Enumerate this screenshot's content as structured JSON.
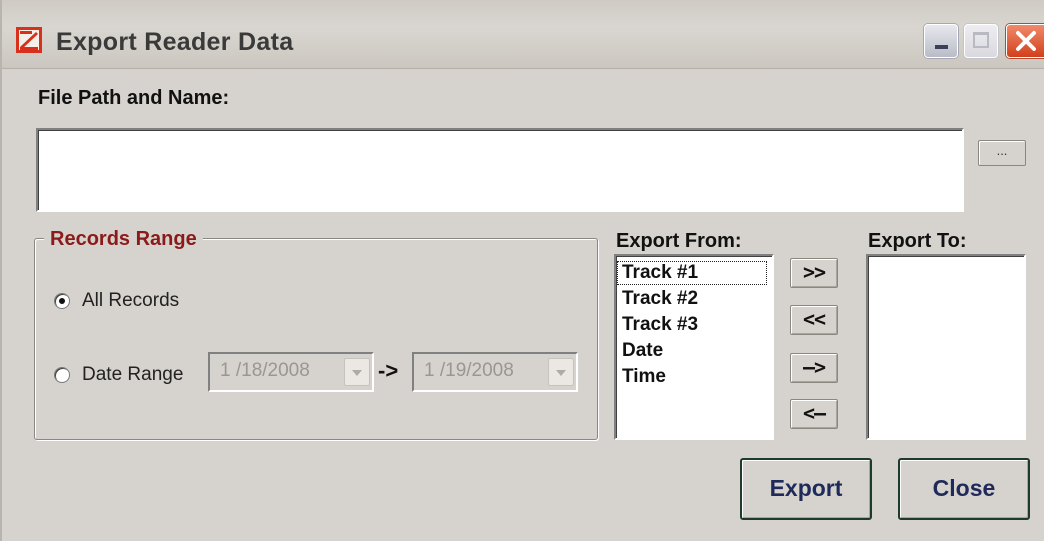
{
  "window": {
    "title": "Export Reader Data",
    "controls": {
      "minimize": "minimize-icon",
      "maximize": "maximize-icon",
      "close": "close-icon"
    }
  },
  "file": {
    "label": "File Path and Name:",
    "value": "",
    "browse_label": "..."
  },
  "records_range": {
    "legend": "Records Range",
    "all_records_label": "All Records",
    "all_records_checked": true,
    "date_range_label": "Date Range",
    "date_range_checked": false,
    "start_date": "1 /18/2008",
    "separator": "->",
    "end_date": "1 /19/2008"
  },
  "export_from": {
    "label": "Export From:",
    "items": [
      "Track #1",
      "Track #2",
      "Track #3",
      "Date",
      "Time"
    ],
    "focused_index": 0
  },
  "export_to": {
    "label": "Export To:",
    "items": []
  },
  "move_buttons": {
    "add_all": ">>",
    "remove_all": "<<",
    "add_one": "—>",
    "remove_one": "<—"
  },
  "actions": {
    "export": "Export",
    "close": "Close"
  },
  "colors": {
    "legend": "#8b1a1a",
    "close_button": "#d2401c",
    "window_bg": "#d6d2cd"
  }
}
